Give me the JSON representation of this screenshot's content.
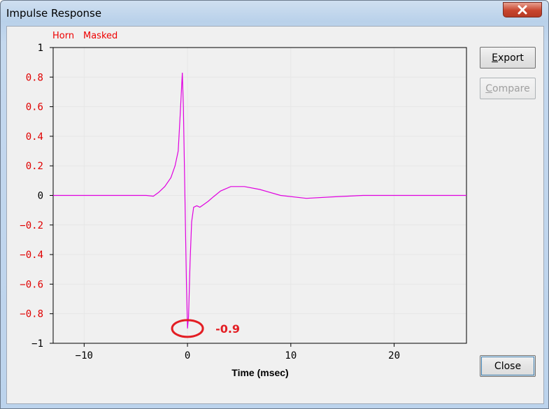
{
  "window": {
    "title": "Impulse Response"
  },
  "legend": [
    {
      "label": "Horn",
      "color": "#e00000"
    },
    {
      "label": "Masked",
      "color": "#e00000"
    }
  ],
  "buttons": {
    "export": {
      "label": "Export",
      "mnemonic": "E",
      "rest": "xport",
      "enabled": true
    },
    "compare": {
      "label": "Compare",
      "mnemonic": "C",
      "rest": "ompare",
      "enabled": false
    },
    "close": {
      "label": "Close"
    }
  },
  "annotation": {
    "text": "-0.9",
    "color": "#e31e24"
  },
  "chart_data": {
    "type": "line",
    "xlabel": "Time (msec)",
    "ylabel": "",
    "xlim": [
      -13,
      27
    ],
    "ylim": [
      -1,
      1
    ],
    "x_ticks": [
      -10,
      0,
      10,
      20
    ],
    "x_tick_labels": [
      "−10",
      "0",
      "10",
      "20"
    ],
    "y_ticks": [
      1,
      0.8,
      0.6,
      0.4,
      0.2,
      0,
      -0.2,
      -0.4,
      -0.6,
      -0.8,
      -1
    ],
    "y_tick_labels": [
      "1",
      "0.8",
      "0.6",
      "0.4",
      "0.2",
      "0",
      "−0.2",
      "−0.4",
      "−0.6",
      "−0.8",
      "−1"
    ],
    "grid": true,
    "series": [
      {
        "color": "#e000e0",
        "x": [
          -13,
          -4,
          -3.3,
          -2.8,
          -2.2,
          -1.6,
          -1.2,
          -0.9,
          -0.7,
          -0.5,
          -0.4,
          -0.25,
          -0.1,
          0.0,
          0.1,
          0.25,
          0.4,
          0.6,
          0.9,
          1.2,
          1.6,
          2.0,
          2.5,
          3.2,
          4.2,
          5.5,
          7,
          9,
          11.5,
          14,
          17,
          20,
          23,
          27
        ],
        "y": [
          0,
          0,
          -0.005,
          0.02,
          0.06,
          0.12,
          0.2,
          0.3,
          0.55,
          0.83,
          0.6,
          0.0,
          -0.6,
          -0.9,
          -0.82,
          -0.45,
          -0.18,
          -0.08,
          -0.07,
          -0.08,
          -0.06,
          -0.04,
          -0.01,
          0.03,
          0.06,
          0.06,
          0.04,
          0.0,
          -0.02,
          -0.01,
          0.0,
          0.0,
          0.0,
          0.0
        ]
      }
    ],
    "marked_point": {
      "x": 0,
      "y": -0.9
    }
  }
}
